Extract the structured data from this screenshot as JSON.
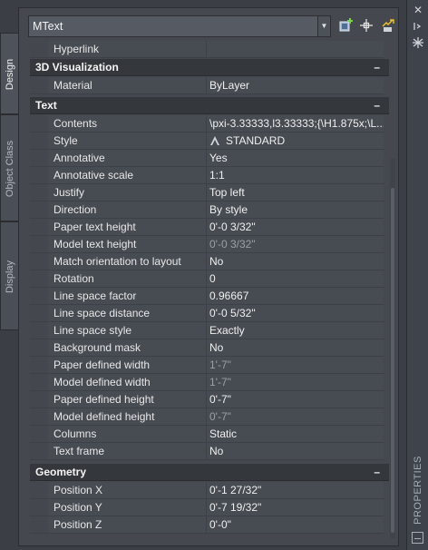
{
  "tabs": [
    {
      "label": "Design",
      "active": true
    },
    {
      "label": "Object Class",
      "active": false
    },
    {
      "label": "Display",
      "active": false
    }
  ],
  "object_select": {
    "value": "MText"
  },
  "toolbar": {
    "icons": [
      "add-selection-icon",
      "select-objects-icon",
      "quick-select-icon"
    ]
  },
  "palette": {
    "title": "PROPERTIES",
    "strip_icons": [
      "close-icon",
      "autohide-icon",
      "properties-menu-icon",
      "palette-options-icon"
    ]
  },
  "partial_row": {
    "label": "Hyperlink",
    "value": ""
  },
  "categories": [
    {
      "name": "3D Visualization",
      "toggle": "–",
      "rows": [
        {
          "label": "Material",
          "value": "ByLayer"
        }
      ]
    },
    {
      "name": "Text",
      "toggle": "–",
      "rows": [
        {
          "label": "Contents",
          "value": "\\pxi-3.33333,l3.33333;{\\H1.875x;\\L..."
        },
        {
          "label": "Style",
          "value": "STANDARD",
          "icon": "text-style-icon"
        },
        {
          "label": "Annotative",
          "value": "Yes"
        },
        {
          "label": "Annotative scale",
          "value": "1:1"
        },
        {
          "label": "Justify",
          "value": "Top left"
        },
        {
          "label": "Direction",
          "value": "By style"
        },
        {
          "label": "Paper text height",
          "value": "0'-0 3/32\""
        },
        {
          "label": "Model text height",
          "value": "0'-0 3/32\"",
          "dim": true
        },
        {
          "label": "Match orientation to layout",
          "value": "No"
        },
        {
          "label": "Rotation",
          "value": "0"
        },
        {
          "label": "Line space factor",
          "value": "0.96667"
        },
        {
          "label": "Line space distance",
          "value": "0'-0 5/32\""
        },
        {
          "label": "Line space style",
          "value": "Exactly"
        },
        {
          "label": "Background mask",
          "value": "No"
        },
        {
          "label": "Paper defined width",
          "value": "1'-7\"",
          "dim": true
        },
        {
          "label": "Model defined width",
          "value": "1'-7\"",
          "dim": true
        },
        {
          "label": "Paper defined height",
          "value": "0'-7\""
        },
        {
          "label": "Model defined height",
          "value": "0'-7\"",
          "dim": true
        },
        {
          "label": "Columns",
          "value": "Static"
        },
        {
          "label": "Text frame",
          "value": "No"
        }
      ]
    },
    {
      "name": "Geometry",
      "toggle": "–",
      "rows": [
        {
          "label": "Position X",
          "value": "0'-1 27/32\""
        },
        {
          "label": "Position Y",
          "value": "0'-7 19/32\""
        },
        {
          "label": "Position Z",
          "value": "0'-0\""
        }
      ]
    }
  ]
}
